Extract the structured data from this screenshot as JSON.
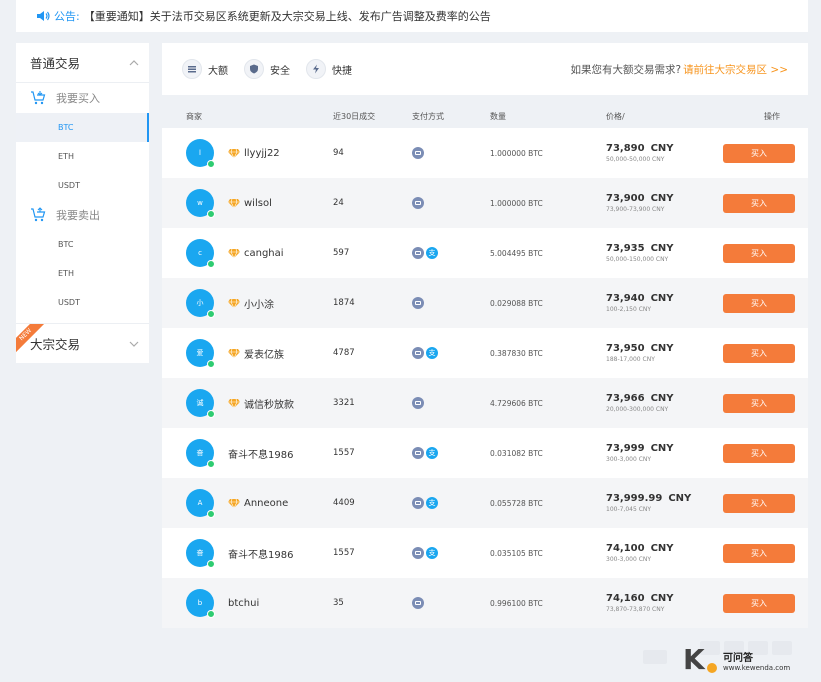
{
  "notice": {
    "label": "公告:",
    "text": "【重要通知】关于法币交易区系统更新及大宗交易上线、发布广告调整及费率的公告"
  },
  "sidebar": {
    "normal_trade": "普通交易",
    "buy_group": "我要买入",
    "buy_items": [
      "BTC",
      "ETH",
      "USDT"
    ],
    "sell_group": "我要卖出",
    "sell_items": [
      "BTC",
      "ETH",
      "USDT"
    ],
    "bulk_trade": "大宗交易",
    "new_badge": "NEW",
    "active_item": "BTC"
  },
  "features": [
    {
      "icon": "large-amount-icon",
      "label": "大额"
    },
    {
      "icon": "shield-icon",
      "label": "安全"
    },
    {
      "icon": "lightning-icon",
      "label": "快捷"
    }
  ],
  "bulk_hint": {
    "text": "如果您有大额交易需求?",
    "link": "请前往大宗交易区 >>"
  },
  "table": {
    "headers": {
      "merchant": "商家",
      "volume": "近30日成交",
      "payment": "支付方式",
      "quantity": "数量",
      "price": "价格/",
      "action": "操作"
    },
    "buy_label": "买入",
    "rows": [
      {
        "avatar": "l",
        "verified": true,
        "name": "llyyjj22",
        "volume": "94",
        "pay": [
          "bank"
        ],
        "qty": "1.000000 BTC",
        "price": "73,890",
        "currency": "CNY",
        "range": "50,000-50,000 CNY"
      },
      {
        "avatar": "w",
        "verified": true,
        "name": "wilsol",
        "volume": "24",
        "pay": [
          "bank"
        ],
        "qty": "1.000000 BTC",
        "price": "73,900",
        "currency": "CNY",
        "range": "73,900-73,900 CNY"
      },
      {
        "avatar": "c",
        "verified": true,
        "name": "canghai",
        "volume": "597",
        "pay": [
          "bank",
          "alipay"
        ],
        "qty": "5.004495 BTC",
        "price": "73,935",
        "currency": "CNY",
        "range": "50,000-150,000 CNY"
      },
      {
        "avatar": "小",
        "verified": true,
        "name": "小小涂",
        "volume": "1874",
        "pay": [
          "bank"
        ],
        "qty": "0.029088 BTC",
        "price": "73,940",
        "currency": "CNY",
        "range": "100-2,150 CNY"
      },
      {
        "avatar": "爱",
        "verified": true,
        "name": "爱表亿族",
        "volume": "4787",
        "pay": [
          "bank",
          "alipay"
        ],
        "qty": "0.387830 BTC",
        "price": "73,950",
        "currency": "CNY",
        "range": "188-17,000 CNY"
      },
      {
        "avatar": "诚",
        "verified": true,
        "name": "诚信秒放款",
        "volume": "3321",
        "pay": [
          "bank"
        ],
        "qty": "4.729606 BTC",
        "price": "73,966",
        "currency": "CNY",
        "range": "20,000-300,000 CNY"
      },
      {
        "avatar": "奋",
        "verified": false,
        "name": "奋斗不息1986",
        "volume": "1557",
        "pay": [
          "bank",
          "alipay"
        ],
        "qty": "0.031082 BTC",
        "price": "73,999",
        "currency": "CNY",
        "range": "300-3,000 CNY"
      },
      {
        "avatar": "A",
        "verified": true,
        "name": "Anneone",
        "volume": "4409",
        "pay": [
          "bank",
          "alipay"
        ],
        "qty": "0.055728 BTC",
        "price": "73,999.99",
        "currency": "CNY",
        "range": "100-7,045 CNY"
      },
      {
        "avatar": "奋",
        "verified": false,
        "name": "奋斗不息1986",
        "volume": "1557",
        "pay": [
          "bank",
          "alipay"
        ],
        "qty": "0.035105 BTC",
        "price": "74,100",
        "currency": "CNY",
        "range": "300-3,000 CNY"
      },
      {
        "avatar": "b",
        "verified": false,
        "name": "btchui",
        "volume": "35",
        "pay": [
          "bank"
        ],
        "qty": "0.996100 BTC",
        "price": "74,160",
        "currency": "CNY",
        "range": "73,870-73,870 CNY"
      }
    ]
  },
  "watermark": {
    "title": "可问答",
    "url": "www.kewenda.com"
  },
  "colors": {
    "accent": "#2196f3",
    "buy": "#f47b3a",
    "link": "#f7941d",
    "avatar": "#1aa7f0",
    "online": "#2ecc71"
  }
}
